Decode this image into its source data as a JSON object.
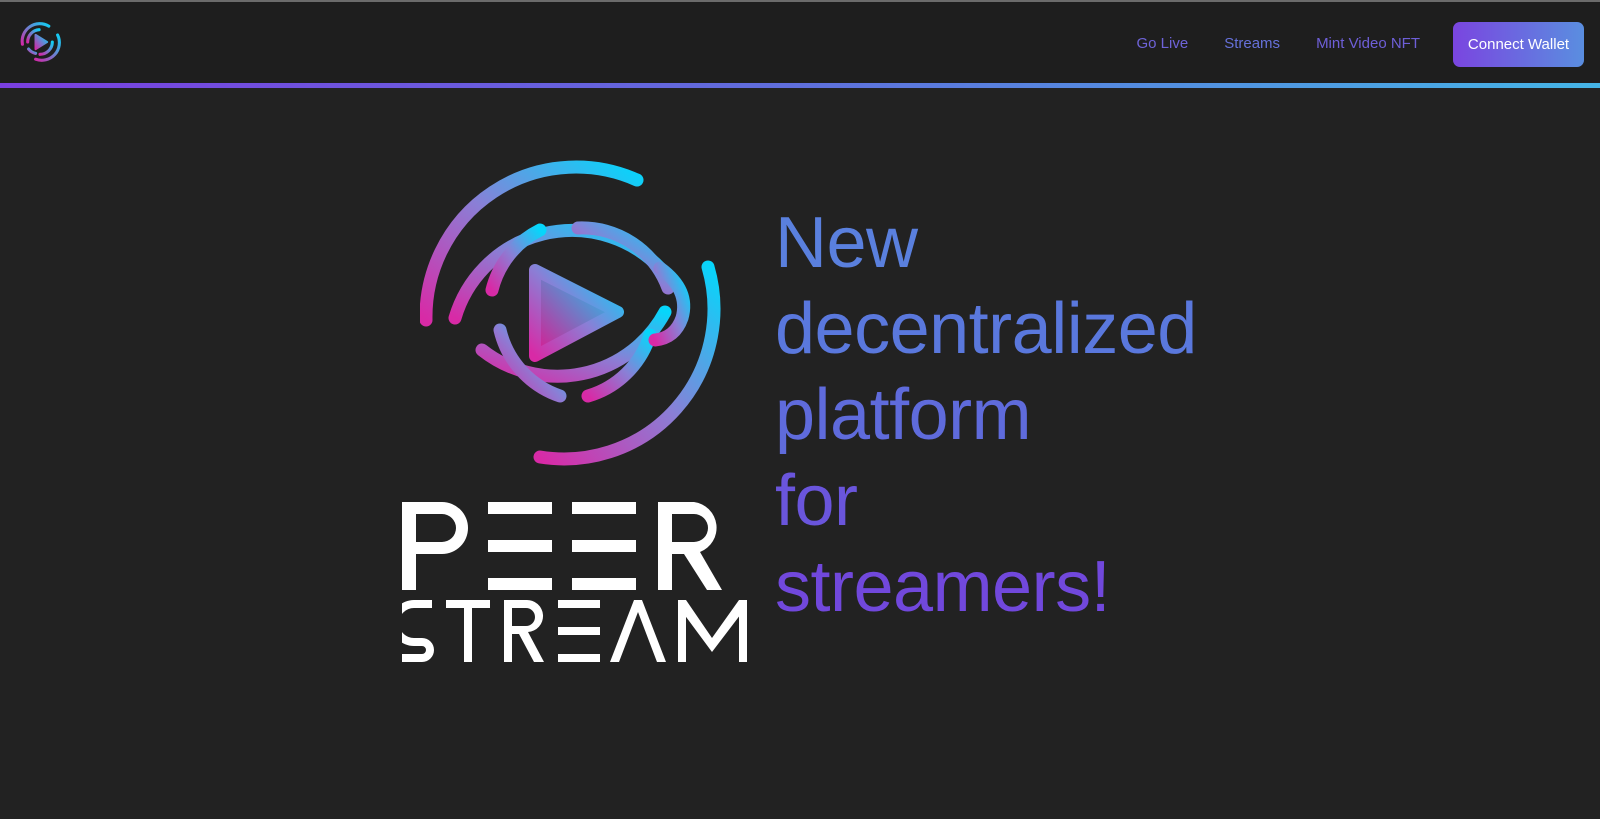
{
  "nav": {
    "links": [
      {
        "label": "Go Live",
        "color": "#6e63d8"
      },
      {
        "label": "Streams",
        "color": "#6671da"
      },
      {
        "label": "Mint Video NFT",
        "color": "#6e5fd8"
      }
    ],
    "connect_label": "Connect Wallet"
  },
  "hero": {
    "headline_lines": [
      {
        "text": "New",
        "color": "#5a80de"
      },
      {
        "text": "decentralized",
        "color": "#5a78dd"
      },
      {
        "text": "platform",
        "color": "#5f6bdc"
      },
      {
        "text": "for",
        "color": "#6a55dc"
      },
      {
        "text": "streamers!",
        "color": "#7148dc"
      }
    ],
    "logo_wordmark": [
      "PEER",
      "STREAM"
    ]
  },
  "colors": {
    "background": "#222222",
    "navbar": "#1e1e1e",
    "accent_purple": "#7a45e0",
    "accent_blue": "#45b5e6",
    "accent_cyan": "#0fd0f5",
    "accent_magenta": "#d02aa8"
  },
  "icons": {
    "brand": "peerstream-logo-icon",
    "play": "play-icon"
  }
}
